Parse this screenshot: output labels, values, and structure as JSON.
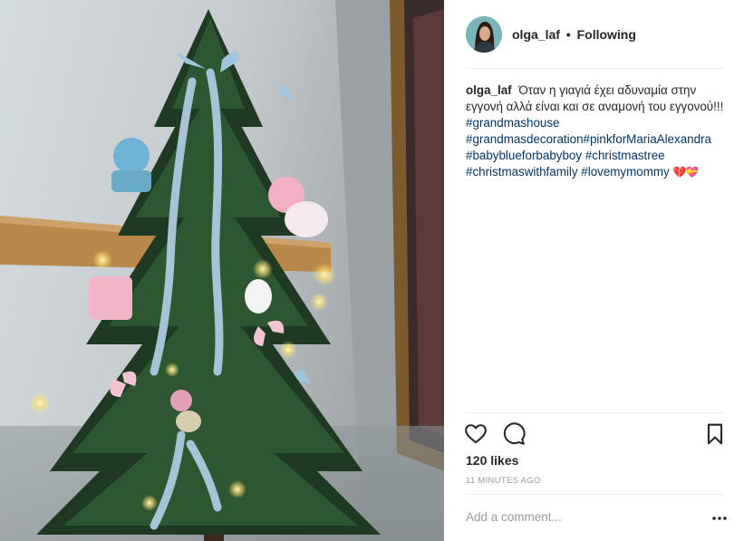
{
  "post": {
    "username": "olga_laf",
    "separator": "•",
    "follow_status": "Following",
    "caption": {
      "username": "olga_laf",
      "text": "Όταν η γιαγιά έχει αδυναμία στην εγγονή αλλά είναι και σε αναμονή του εγγονού!!!",
      "hashtags": [
        "#grandmashouse",
        "#grandmasdecoration",
        "#pinkforMariaAlexandra",
        "#babyblueforbabyboy",
        "#christmastree",
        "#christmaswithfamily",
        "#lovemymommy"
      ],
      "emoji": "💔💝"
    },
    "likes": "120 likes",
    "time": "11 MINUTES AGO",
    "comment_placeholder": "Add a comment..."
  },
  "icons": {
    "like": "heart-icon",
    "comment": "comment-bubble-icon",
    "save": "bookmark-icon",
    "more": "more-options-icon"
  }
}
